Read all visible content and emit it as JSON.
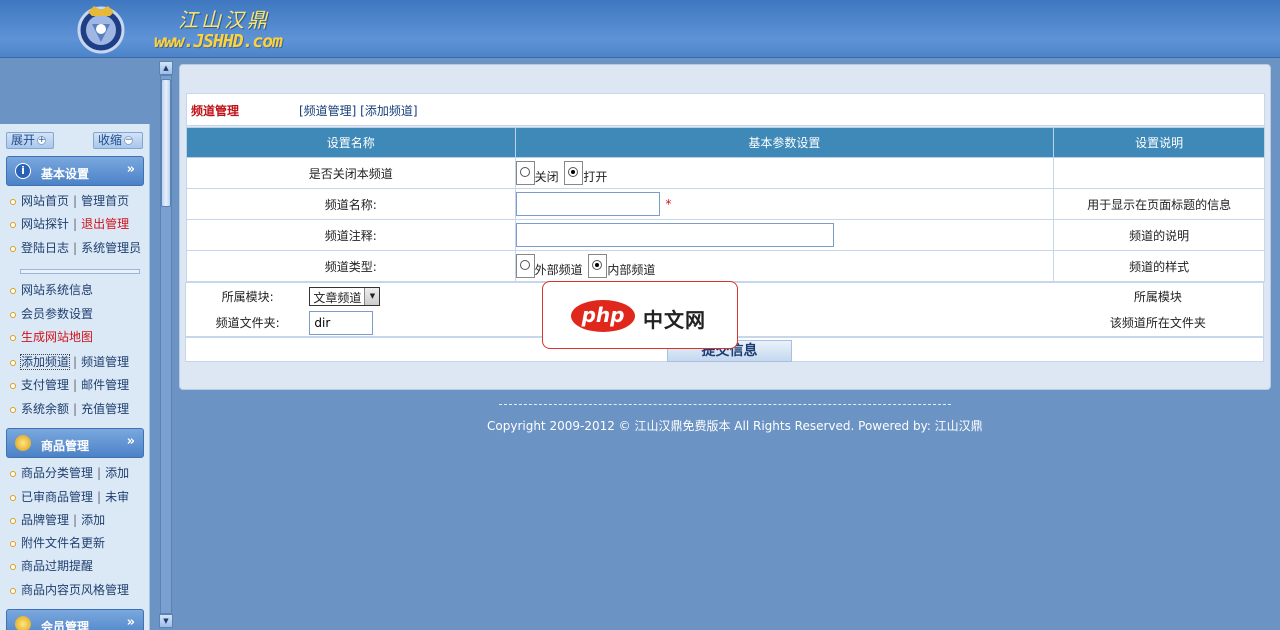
{
  "header": {
    "logo_cn": "江山汉鼎",
    "logo_url": "www.JSHHD.com"
  },
  "sidebar": {
    "expand_label": "展开",
    "collapse_label": "收缩",
    "sections": [
      {
        "title": "基本设置",
        "items": [
          {
            "a": "网站首页",
            "b": "管理首页"
          },
          {
            "a": "网站探针",
            "b": "退出管理"
          },
          {
            "a": "登陆日志",
            "b": "系统管理员"
          },
          {
            "a": "网站系统信息"
          },
          {
            "a": "会员参数设置"
          },
          {
            "a": "生成网站地图"
          },
          {
            "a": "添加频道",
            "b": "频道管理"
          },
          {
            "a": "支付管理",
            "b": "邮件管理"
          },
          {
            "a": "系统余额",
            "b": "充值管理"
          }
        ]
      },
      {
        "title": "商品管理",
        "items": [
          {
            "a": "商品分类管理",
            "b": "添加"
          },
          {
            "a": "已审商品管理",
            "b": "未审"
          },
          {
            "a": "品牌管理",
            "b": "添加"
          },
          {
            "a": "附件文件名更新"
          },
          {
            "a": "商品过期提醒"
          },
          {
            "a": "商品内容页风格管理"
          }
        ]
      },
      {
        "title": "会员管理",
        "items": []
      }
    ],
    "separator": "|"
  },
  "breadcrumb": {
    "title": "频道管理",
    "links": "[频道管理] [添加频道]"
  },
  "form": {
    "headers": [
      "设置名称",
      "基本参数设置",
      "设置说明"
    ],
    "rows": [
      {
        "label": "是否关闭本频道",
        "opt1": "关闭",
        "opt2": "打开",
        "desc": ""
      },
      {
        "label": "频道名称:",
        "required": "*",
        "desc": "用于显示在页面标题的信息"
      },
      {
        "label": "频道注释:",
        "desc": "频道的说明"
      },
      {
        "label": "频道类型:",
        "opt1": "外部频道",
        "opt2": "内部频道",
        "desc": "频道的样式"
      }
    ],
    "module": {
      "label": "所属模块:",
      "selected": "文章频道",
      "desc": "所属模块"
    },
    "folder": {
      "label": "频道文件夹:",
      "value": "dir",
      "desc": "该频道所在文件夹"
    },
    "submit_label": "提交信息"
  },
  "watermark": {
    "php": "php",
    "cn": "中文网"
  },
  "footer": {
    "text": "Copyright 2009-2012 © 江山汉鼎免费版本 All Rights Reserved. Powered by:  江山汉鼎"
  },
  "colors": {
    "accent_red": "#c0131a",
    "header_blue": "#3f78c0",
    "table_head": "#3f89b8"
  }
}
